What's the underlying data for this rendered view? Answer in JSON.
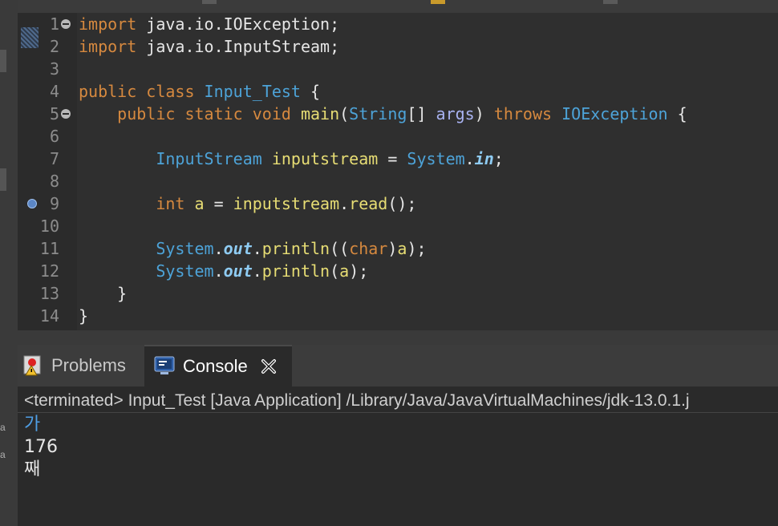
{
  "editor": {
    "lines": [
      {
        "n": "1",
        "tokens": [
          {
            "t": "import",
            "c": "kw"
          },
          {
            "t": " java.io.IOException;",
            "c": ""
          }
        ]
      },
      {
        "n": "2",
        "tokens": [
          {
            "t": "import",
            "c": "kw"
          },
          {
            "t": " java.io.InputStream;",
            "c": ""
          }
        ]
      },
      {
        "n": "3",
        "tokens": []
      },
      {
        "n": "4",
        "tokens": [
          {
            "t": "public class ",
            "c": "kw"
          },
          {
            "t": "Input_Test",
            "c": "ty"
          },
          {
            "t": " {",
            "c": ""
          }
        ]
      },
      {
        "n": "5",
        "tokens": [
          {
            "t": "    public static void ",
            "c": "kw"
          },
          {
            "t": "main",
            "c": "fn"
          },
          {
            "t": "(",
            "c": ""
          },
          {
            "t": "String",
            "c": "ty"
          },
          {
            "t": "[] ",
            "c": ""
          },
          {
            "t": "args",
            "c": "pm"
          },
          {
            "t": ") ",
            "c": ""
          },
          {
            "t": "throws ",
            "c": "kw"
          },
          {
            "t": "IOException",
            "c": "ty"
          },
          {
            "t": " {",
            "c": ""
          }
        ]
      },
      {
        "n": "6",
        "tokens": []
      },
      {
        "n": "7",
        "tokens": [
          {
            "t": "        ",
            "c": ""
          },
          {
            "t": "InputStream",
            "c": "ty"
          },
          {
            "t": " ",
            "c": ""
          },
          {
            "t": "inputstream",
            "c": "fn"
          },
          {
            "t": " = ",
            "c": ""
          },
          {
            "t": "System",
            "c": "ty"
          },
          {
            "t": ".",
            "c": ""
          },
          {
            "t": "in",
            "c": "it"
          },
          {
            "t": ";",
            "c": ""
          }
        ]
      },
      {
        "n": "8",
        "tokens": []
      },
      {
        "n": "9",
        "tokens": [
          {
            "t": "        ",
            "c": ""
          },
          {
            "t": "int ",
            "c": "kw"
          },
          {
            "t": "a",
            "c": "fn"
          },
          {
            "t": " = ",
            "c": ""
          },
          {
            "t": "inputstream",
            "c": "fn"
          },
          {
            "t": ".",
            "c": ""
          },
          {
            "t": "read",
            "c": "fn"
          },
          {
            "t": "();",
            "c": ""
          }
        ]
      },
      {
        "n": "10",
        "tokens": []
      },
      {
        "n": "11",
        "tokens": [
          {
            "t": "        ",
            "c": ""
          },
          {
            "t": "System",
            "c": "ty"
          },
          {
            "t": ".",
            "c": ""
          },
          {
            "t": "out",
            "c": "it"
          },
          {
            "t": ".",
            "c": ""
          },
          {
            "t": "println",
            "c": "fn"
          },
          {
            "t": "((",
            "c": ""
          },
          {
            "t": "char",
            "c": "kw"
          },
          {
            "t": ")",
            "c": ""
          },
          {
            "t": "a",
            "c": "fn"
          },
          {
            "t": ");",
            "c": ""
          }
        ]
      },
      {
        "n": "12",
        "tokens": [
          {
            "t": "        ",
            "c": ""
          },
          {
            "t": "System",
            "c": "ty"
          },
          {
            "t": ".",
            "c": ""
          },
          {
            "t": "out",
            "c": "it"
          },
          {
            "t": ".",
            "c": ""
          },
          {
            "t": "println",
            "c": "fn"
          },
          {
            "t": "(",
            "c": ""
          },
          {
            "t": "a",
            "c": "fn"
          },
          {
            "t": ");",
            "c": ""
          }
        ]
      },
      {
        "n": "13",
        "tokens": [
          {
            "t": "    }",
            "c": ""
          }
        ]
      },
      {
        "n": "14",
        "tokens": [
          {
            "t": "}",
            "c": ""
          }
        ]
      }
    ]
  },
  "tabs": {
    "problems_label": "Problems",
    "console_label": "Console"
  },
  "console": {
    "header": "<terminated> Input_Test [Java Application] /Library/Java/JavaVirtualMachines/jdk-13.0.1.j",
    "output": [
      {
        "text": "가",
        "color": "#4f9fe6"
      },
      {
        "text": "176",
        "color": "#e6e6e6"
      },
      {
        "text": "째",
        "color": "#e6e6e6"
      }
    ]
  },
  "sidebar": {
    "labels": [
      "a",
      "a"
    ]
  }
}
